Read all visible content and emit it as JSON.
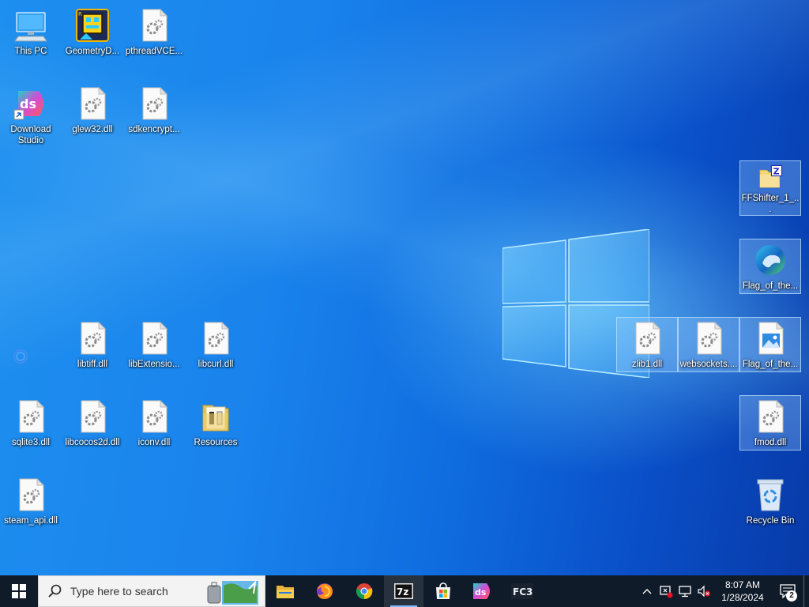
{
  "desktop": {
    "icons": [
      {
        "label": "This PC",
        "type": "computer"
      },
      {
        "label": "GeometryD...",
        "type": "game"
      },
      {
        "label": "pthreadVCE...",
        "type": "dll"
      },
      {
        "label": "Download Studio",
        "type": "ds-shortcut"
      },
      {
        "label": "glew32.dll",
        "type": "dll"
      },
      {
        "label": "sdkencrypt...",
        "type": "dll"
      },
      {
        "label": "libtiff.dll",
        "type": "dll"
      },
      {
        "label": "libExtensio...",
        "type": "dll"
      },
      {
        "label": "libcurl.dll",
        "type": "dll"
      },
      {
        "label": "sqlite3.dll",
        "type": "dll"
      },
      {
        "label": "libcocos2d.dll",
        "type": "dll"
      },
      {
        "label": "iconv.dll",
        "type": "dll"
      },
      {
        "label": "Resources",
        "type": "folder"
      },
      {
        "label": "steam_api.dll",
        "type": "dll"
      },
      {
        "label": "FFShifter_1_...",
        "type": "zip-folder"
      },
      {
        "label": "Flag_of_the...",
        "type": "edge"
      },
      {
        "label": "zlib1.dll",
        "type": "dll"
      },
      {
        "label": "websockets....",
        "type": "dll"
      },
      {
        "label": "Flag_of_the...",
        "type": "image"
      },
      {
        "label": "fmod.dll",
        "type": "dll"
      },
      {
        "label": "Recycle Bin",
        "type": "recycle-bin"
      }
    ]
  },
  "taskbar": {
    "search_placeholder": "Type here to search",
    "apps": [
      "file-explorer-icon",
      "firefox-icon",
      "chrome-icon",
      "7zip-icon",
      "microsoft-store-icon",
      "download-studio-icon",
      "fc3-icon"
    ],
    "app_fc3_label": "FC3",
    "app_7z_label": "7z",
    "clock_time": "8:07 AM",
    "clock_date": "1/28/2024",
    "notification_count": "2"
  },
  "colors": {
    "taskbar": "#101b2a",
    "desktop_accent": "#1a83ec"
  }
}
